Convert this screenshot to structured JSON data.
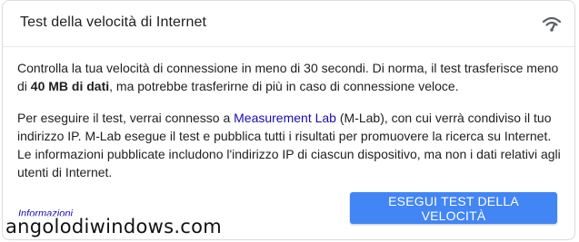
{
  "card": {
    "title": "Test della velocità di Internet",
    "icon": "speed-test-wifi-icon"
  },
  "paragraph1": {
    "before": "Controlla la tua velocità di connessione in meno di 30 secondi. Di norma, il test trasferisce meno di ",
    "bold": "40 MB di dati",
    "after": ", ma potrebbe trasferirne di più in caso di connessione veloce."
  },
  "paragraph2": {
    "before": "Per eseguire il test, verrai connesso a ",
    "link": "Measurement Lab",
    "after": " (M-Lab), con cui verrà condiviso il tuo indirizzo IP. M-Lab esegue il test e pubblica tutti i risultati per promuovere la ricerca su Internet. Le informazioni pubblicate includono l'indirizzo IP di ciascun dispositivo, ma non i dati relativi agli utenti di Internet."
  },
  "footer": {
    "info_link": "Informazioni",
    "run_button": "ESEGUI TEST DELLA VELOCITÀ"
  },
  "watermark": "angolodiwindows.com",
  "colors": {
    "accent": "#4285f4",
    "link": "#1a0dab"
  }
}
